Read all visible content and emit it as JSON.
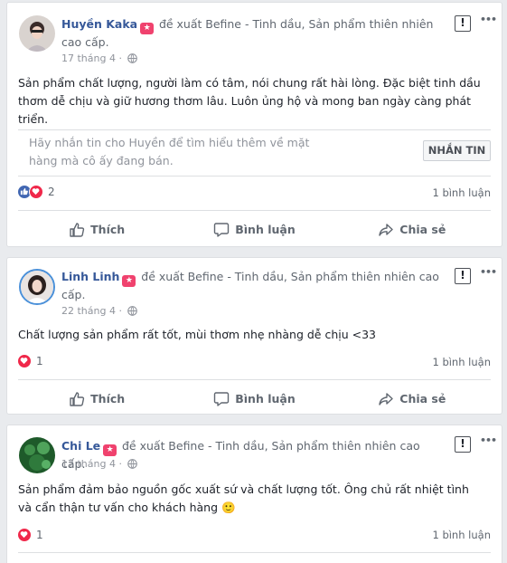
{
  "colors": {
    "link": "#365899",
    "badge": "#f0426e",
    "like": "#4267b2",
    "love": "#f0284a"
  },
  "labels": {
    "recommends": "đề xuất",
    "like": "Thích",
    "comment": "Bình luận",
    "share": "Chia sẻ",
    "flag_icon": "!"
  },
  "reviews": [
    {
      "author": "Huyền Kaka",
      "page": "Befine - Tinh dầu, Sản phẩm thiên nhiên cao cấp.",
      "date": "17 tháng 4 ·",
      "text": "Sản phẩm chất lượng, người làm có tâm, nói chung rất hài lòng. Đặc biệt tinh dầu thơm dễ chịu và giữ hương thơm lâu. Luôn ủng hộ và mong ban ngày càng phát triển.",
      "message_prompt": "Hãy nhắn tin cho Huyền để tìm hiểu thêm về mặt hàng mà cô ấy đang bán.",
      "message_button": "NHẮN TIN",
      "reactions": [
        "like",
        "love"
      ],
      "reaction_count": "2",
      "comments": "1 bình luận"
    },
    {
      "author": "Linh Linh",
      "page": "Befine - Tinh dầu, Sản phẩm thiên nhiên cao cấp.",
      "date": "22 tháng 4 ·",
      "text": "Chất lượng sản phẩm rất tốt, mùi thơm nhẹ nhàng dễ chịu <33",
      "reactions": [
        "love"
      ],
      "reaction_count": "1",
      "comments": "1 bình luận"
    },
    {
      "author": "Chi Le",
      "page": "Befine - Tinh dầu, Sản phẩm thiên nhiên cao cấp.",
      "date": "17 tháng 4 ·",
      "text": "Sản phẩm đảm bảo nguồn gốc xuất sứ và chất lượng tốt. Ông chủ rất nhiệt tình và cẩn thận tư vấn cho khách hàng 🙂",
      "reactions": [
        "love"
      ],
      "reaction_count": "1",
      "comments": "1 bình luận"
    }
  ]
}
